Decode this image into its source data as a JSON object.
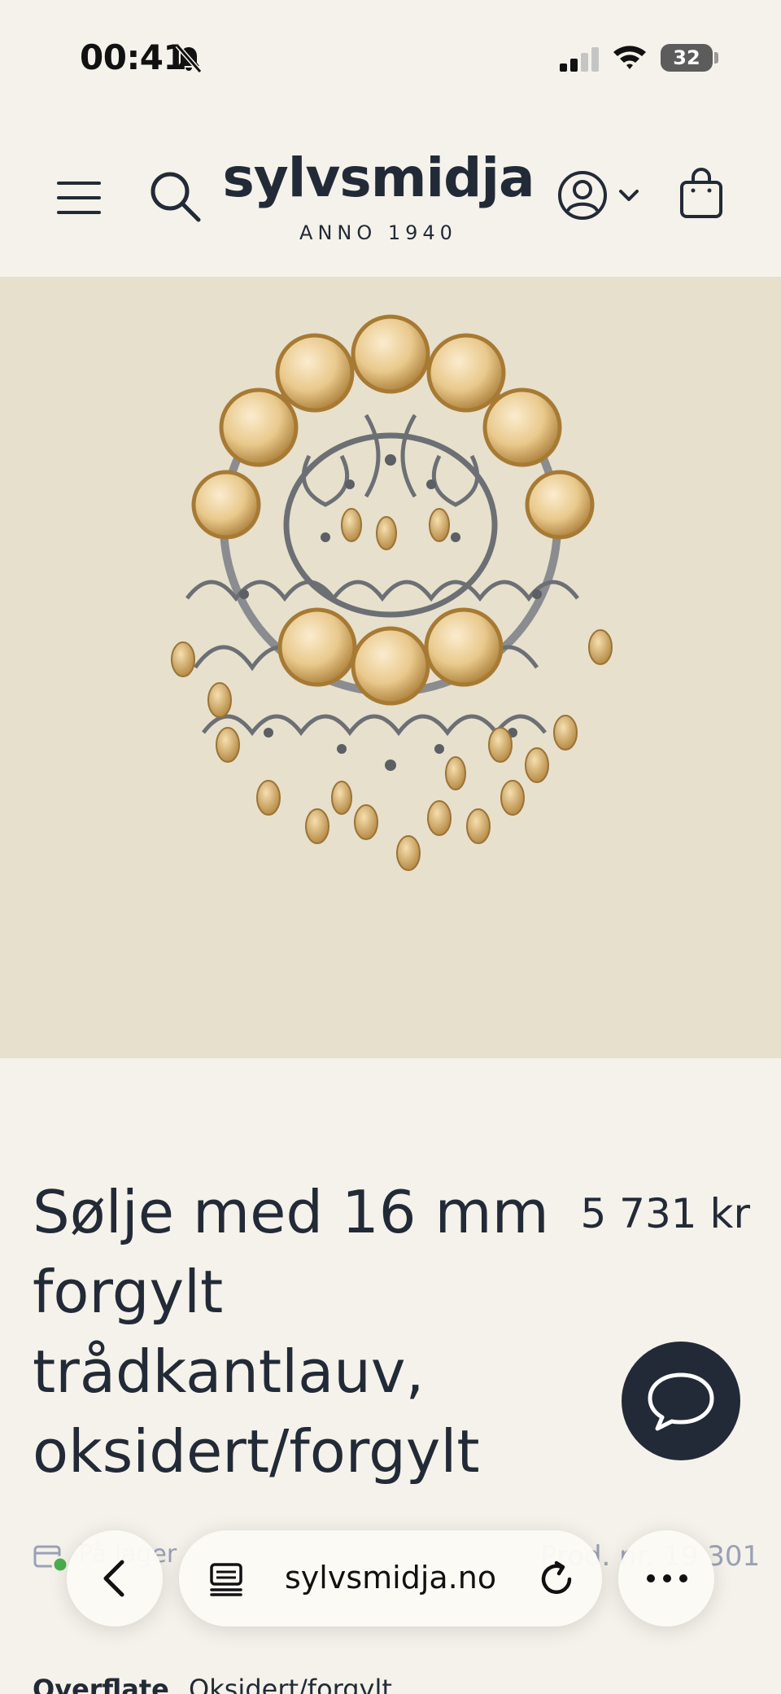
{
  "status_bar": {
    "time": "00:41",
    "battery": "32",
    "icons": [
      "bell-off-icon",
      "signal-icon",
      "wifi-icon",
      "battery-icon"
    ]
  },
  "header": {
    "logo": "sylvsmidja",
    "logo_subtitle": "ANNO 1940",
    "icons": [
      "menu-icon",
      "search-icon",
      "account-icon",
      "chevron-down-icon",
      "bag-icon"
    ]
  },
  "product": {
    "title": "Sølje med 16 mm forgylt trådkantlauv, oksidert/forgylt",
    "price": "5 731 kr",
    "stock_text": "På lager",
    "product_number": "Prod. nr. 19 301",
    "specs": [
      {
        "label": "Overflate",
        "value": "Oksidert/forgylt"
      }
    ]
  },
  "browser": {
    "url": "sylvsmidja.no",
    "icons": [
      "back-icon",
      "page-icon",
      "reload-icon",
      "more-icon"
    ]
  },
  "colors": {
    "background": "#f4f2ea",
    "image_bg": "#e7e0cd",
    "text": "#232a37",
    "muted": "#9aa1b5"
  }
}
